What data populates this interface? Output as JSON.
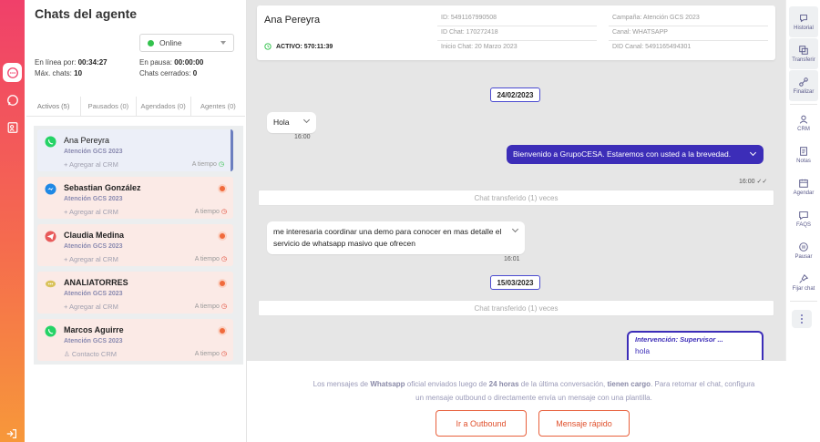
{
  "rail": {
    "items": [
      "chat-icon",
      "whatsapp-icon",
      "contacts-icon"
    ],
    "logout": "logout-icon"
  },
  "agent": {
    "title": "Chats del agente",
    "status": "Online",
    "stats": {
      "online_label": "En línea por:",
      "online_value": "00:34:27",
      "pause_label": "En pausa:",
      "pause_value": "00:00:00",
      "max_label": "Máx. chats:",
      "max_value": "10",
      "closed_label": "Chats cerrados:",
      "closed_value": "0"
    },
    "tabs": [
      "Activos (5)",
      "Pausados (0)",
      "Agendados (0)",
      "Agentes (0)"
    ]
  },
  "chats": [
    {
      "name": "Ana Pereyra",
      "campaign": "Atención GCS 2023",
      "crm": "+ Agregar al CRM",
      "timer": "A tiempo",
      "channel": "whatsapp",
      "selected": true,
      "alert": false
    },
    {
      "name": "Sebastian González",
      "campaign": "Atención GCS 2023",
      "crm": "+ Agregar al CRM",
      "timer": "A tiempo",
      "channel": "messenger",
      "selected": false,
      "alert": true
    },
    {
      "name": "Claudia Medina",
      "campaign": "Atención GCS 2023",
      "crm": "+ Agregar al CRM",
      "timer": "A tiempo",
      "channel": "telegram",
      "selected": false,
      "alert": true
    },
    {
      "name": "ANALIATORRES",
      "campaign": "Atención GCS 2023",
      "crm": "+ Agregar al CRM",
      "timer": "A tiempo",
      "channel": "webchat",
      "selected": false,
      "alert": true
    },
    {
      "name": "Marcos Aguirre",
      "campaign": "Atención GCS 2023",
      "crm": "Contacto CRM",
      "timer": "A tiempo",
      "channel": "whatsapp",
      "selected": false,
      "alert": true
    }
  ],
  "header": {
    "name": "Ana Pereyra",
    "active": "ACTIVO: 570:11:39",
    "id": "ID: 5491167990508",
    "chat_id": "ID Chat: 170272418",
    "start": "Inicio Chat: 20 Marzo 2023",
    "campaign": "Campaña: Atención GCS 2023",
    "channel": "Canal: WHATSAPP",
    "did": "DID Canal: 5491165494301"
  },
  "messages": {
    "date1": "24/02/2023",
    "m1": "Hola",
    "t1": "16:00",
    "m2": "Bienvenido a GrupoCESA. Estaremos con usted a la brevedad.",
    "t2": "16:00",
    "transfer1": "Chat transferido (1) veces",
    "m3": "me interesaria coordinar una demo para conocer en mas detalle el servicio de whatsapp masivo que ofrecen",
    "t3": "16:01",
    "date2": "15/03/2023",
    "transfer2": "Chat transferido (1) veces",
    "intervention_title": "Intervención: Supervisor ...",
    "intervention_msg": "hola"
  },
  "footer": {
    "t1": "Los mensajes de ",
    "t2": "Whatsapp",
    "t3": " oficial enviados luego de ",
    "t4": "24 horas",
    "t5": " de la última conversación, ",
    "t6": "tienen cargo",
    "t7": ". Para retomar el chat, configura",
    "t8": "un mensaje outbound o directamente envía un mensaje con una plantilla.",
    "outbound": "Ir a Outbound",
    "quick": "Mensaje rápido"
  },
  "tools": [
    "Historial",
    "Transferir",
    "Finalizar",
    "CRM",
    "Notas",
    "Agendar",
    "FAQS",
    "Pausar",
    "Fijar chat"
  ],
  "colors": {
    "accent": "#3c2db8",
    "brand_gradient_top": "#f0406a",
    "brand_gradient_bottom": "#f7983a",
    "alert": "#f06a3c"
  }
}
